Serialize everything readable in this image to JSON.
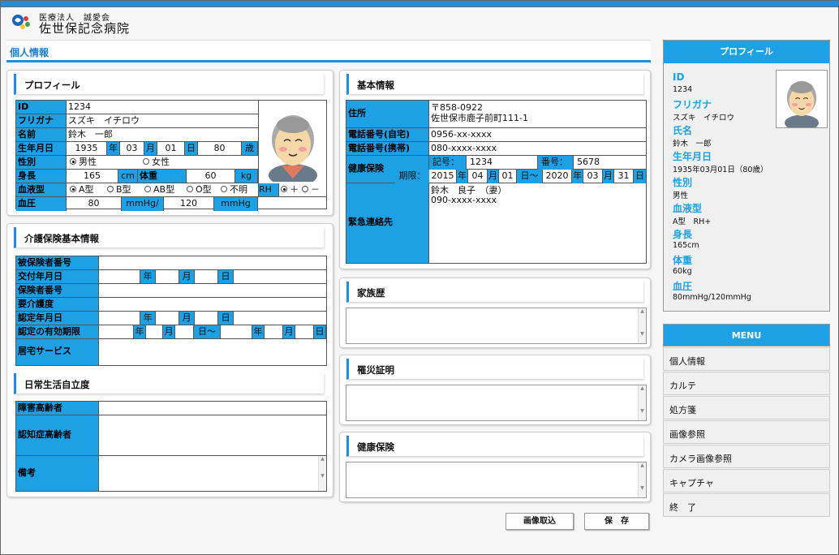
{
  "header": {
    "org": "医療法人　誠愛会",
    "hospital": "佐世保記念病院",
    "tab": "個人情報"
  },
  "profile": {
    "title": "プロフィール",
    "id_label": "ID",
    "id": "1234",
    "kana_label": "フリガナ",
    "kana": "スズキ　イチロウ",
    "name_label": "名前",
    "name": "鈴木　一郎",
    "birth_label": "生年月日",
    "birth_year": "1935",
    "nen": "年",
    "birth_month": "03",
    "tsuki": "月",
    "birth_day": "01",
    "hi": "日",
    "age": "80",
    "sai": "歳",
    "sex_label": "性別",
    "male": "男性",
    "female": "女性",
    "height_label": "身長",
    "height": "165",
    "cm": "cm",
    "weight_label": "体重",
    "weight": "60",
    "kg": "kg",
    "blood_label": "血液型",
    "blood_a": "A型",
    "blood_b": "B型",
    "blood_ab": "AB型",
    "blood_o": "O型",
    "blood_unknown": "不明",
    "rh": "RH",
    "rh_plus": "＋",
    "rh_minus": "－",
    "bp_label": "血圧",
    "bp_high": "80",
    "bp_unit1": "mmHg/",
    "bp_low": "120",
    "bp_unit2": "mmHg"
  },
  "basic": {
    "title": "基本情報",
    "addr_label": "住所",
    "zip": "〒858-0922",
    "addr": "佐世保市鹿子前町111-1",
    "tel_home_label": "電話番号(自宅)",
    "tel_home": "0956-xx-xxxx",
    "tel_mobile_label": "電話番号(携帯)",
    "tel_mobile": "080-xxxx-xxxx",
    "ins_label": "健康保険",
    "kigo_label": "記号：",
    "kigo": "1234",
    "bango_label": "番号：",
    "bango": "5678",
    "kigen_label": "期限：",
    "from_year": "2015",
    "from_month": "04",
    "from_day": "01",
    "nen": "年",
    "tsuki": "月",
    "hi": "日",
    "tilde": "日～",
    "to_year": "2020",
    "to_month": "03",
    "to_day": "31",
    "emergency_label": "緊急連絡先",
    "emergency_line1": "鈴木　良子　（妻）",
    "emergency_line2": "090-xxxx-xxxx"
  },
  "care": {
    "title": "介護保険基本情報",
    "insured_no": "被保険者番号",
    "issue_date": "交付年月日",
    "insurer_no": "保険者番号",
    "care_level": "要介護度",
    "cert_date": "認定年月日",
    "valid_period": "認定の有効期限",
    "home_service": "居宅サービス",
    "nen": "年",
    "tsuki": "月",
    "hi": "日",
    "tilde": "日～"
  },
  "daily": {
    "title": "日常生活自立度",
    "disabled": "障害高齢者",
    "dementia": "認知症高齢者",
    "note": "備考"
  },
  "family": {
    "title": "家族歴"
  },
  "disaster": {
    "title": "罹災証明"
  },
  "health_ins": {
    "title": "健康保険"
  },
  "buttons": {
    "image_import": "画像取込",
    "save": "保　存"
  },
  "side": {
    "title": "プロフィール",
    "id_k": "ID",
    "id_v": "1234",
    "kana_k": "フリガナ",
    "kana_v": "スズキ　イチロウ",
    "name_k": "氏名",
    "name_v": "鈴木　一郎",
    "birth_k": "生年月日",
    "birth_v": "1935年03月01日（80歳）",
    "sex_k": "性別",
    "sex_v": "男性",
    "blood_k": "血液型",
    "blood_v": "A型　RH+",
    "height_k": "身長",
    "height_v": "165cm",
    "weight_k": "体重",
    "weight_v": "60kg",
    "bp_k": "血圧",
    "bp_v": "80mmHg/120mmHg"
  },
  "menu": {
    "title": "MENU",
    "items": [
      "個人情報",
      "カルテ",
      "処方箋",
      "画像参照",
      "カメラ画像参照",
      "キャプチャ",
      "終　了"
    ]
  },
  "colors": {
    "accent": "#1ea0e4",
    "topbar": "#1e8fe0"
  }
}
